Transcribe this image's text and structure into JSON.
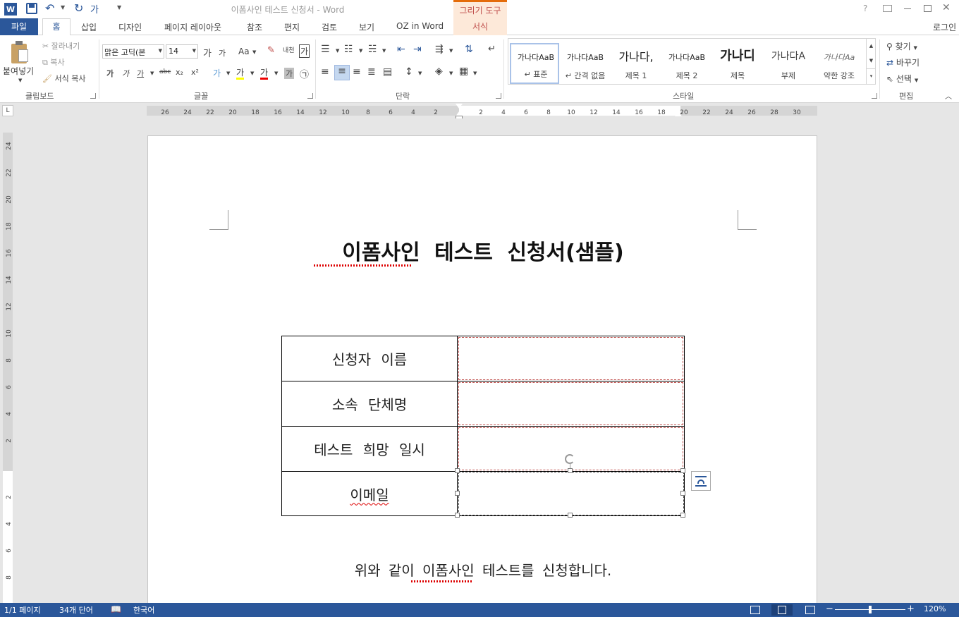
{
  "window": {
    "title": "이폼사인 테스트 신청서 - Word",
    "drawing_tools_label": "그리기 도구",
    "help": "?",
    "login": "로그인"
  },
  "tabs": [
    "파일",
    "홈",
    "삽입",
    "디자인",
    "페이지 레이아웃",
    "참조",
    "편지",
    "검토",
    "보기",
    "OZ in Word",
    "서식"
  ],
  "clipboard": {
    "paste": "붙여넣기",
    "cut": "잘라내기",
    "copy": "복사",
    "format_painter": "서식 복사",
    "label": "클립보드"
  },
  "font": {
    "name": "맑은 고딕(본",
    "size": "14",
    "label": "글꼴",
    "grow": "가",
    "shrink": "가",
    "case": "Aa",
    "bold": "가",
    "italic": "가",
    "underline": "가",
    "strike": "abc",
    "sub": "x₂",
    "sup": "x²",
    "phonetic": "내천",
    "border_char": "가",
    "highlight": "가",
    "font_color": "가",
    "shade": "가",
    "enclose": "㉠",
    "effects": "가"
  },
  "paragraph": {
    "label": "단락"
  },
  "styles": {
    "label": "스타일",
    "items": [
      {
        "preview": "가나다AaB",
        "name": "↵ 표준"
      },
      {
        "preview": "가나다AaB",
        "name": "↵ 간격 없음"
      },
      {
        "preview": "가나다,",
        "name": "제목 1"
      },
      {
        "preview": "가나다AaB",
        "name": "제목 2"
      },
      {
        "preview": "가나디",
        "name": "제목"
      },
      {
        "preview": "가나다A",
        "name": "부제"
      },
      {
        "preview": "가나다Aa",
        "name": "약한 강조"
      }
    ]
  },
  "editing": {
    "find": "찾기",
    "replace": "바꾸기",
    "select": "선택",
    "label": "편집"
  },
  "ruler": {
    "h_left": [
      "26",
      "24",
      "22",
      "20",
      "18",
      "16",
      "14",
      "12",
      "10",
      "8",
      "6",
      "4",
      "2"
    ],
    "h_right": [
      "2",
      "4",
      "6",
      "8",
      "10",
      "12",
      "14",
      "16",
      "18",
      "20",
      "22",
      "24",
      "26",
      "28",
      "30"
    ],
    "v_top": [
      "24",
      "22",
      "20",
      "18",
      "16",
      "14",
      "12",
      "10",
      "8",
      "6",
      "4",
      "2"
    ],
    "v_bottom": [
      "2",
      "4",
      "6",
      "8"
    ],
    "corner": "L"
  },
  "document": {
    "title": "이폼사인 테스트 신청서(샘플)",
    "rows": [
      "신청자 이름",
      "소속 단체명",
      "테스트 희망 일시",
      "이메일"
    ],
    "footer_text": "위와 같이 이폼사인 테스트를 신청합니다."
  },
  "status": {
    "page": "1/1 페이지",
    "words": "34개 단어",
    "language": "한국어",
    "zoom": "120%"
  },
  "colors": {
    "word_blue": "#2b579a",
    "drawing_tools": "#e46c0a",
    "selection_dash": "#c0504d"
  }
}
